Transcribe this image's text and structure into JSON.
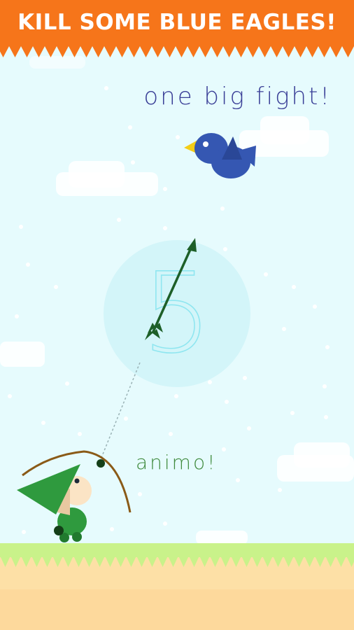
{
  "banner": {
    "text": "KILL SOME BLUE EAGLES!",
    "color": "#f6751a"
  },
  "messages": {
    "top": "one big fight!",
    "middle": "animo!"
  },
  "score": {
    "value": "5"
  },
  "colors": {
    "sky": "#e6fbfd",
    "grass": "#c9f28a",
    "sand": "#fde0a6",
    "eagle": "#3557b2",
    "archer": "#2f9a3e",
    "arrow": "#1d5f28",
    "bow": "#8a5a17"
  }
}
